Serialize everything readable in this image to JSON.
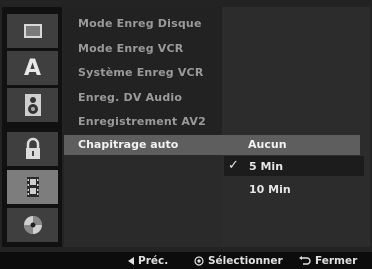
{
  "sidebar": {
    "icons": [
      {
        "name": "disc-panel-icon"
      },
      {
        "name": "language-a-icon"
      },
      {
        "name": "speaker-icon"
      },
      {
        "name": "lock-icon"
      },
      {
        "name": "film-strip-icon"
      },
      {
        "name": "disc-icon"
      }
    ],
    "selected_index": 4
  },
  "menu": {
    "items": [
      "Mode Enreg Disque",
      "Mode Enreg VCR",
      "Système Enreg VCR",
      "Enreg. DV Audio",
      "Enregistrement AV2"
    ],
    "highlighted": "Chapitrage auto",
    "current_value": "Aucun"
  },
  "options": {
    "items": [
      "5 Min",
      "10 Min"
    ],
    "checked_index": 0,
    "check_glyph": "✓"
  },
  "footer": {
    "prev_label": "Préc.",
    "select_label": "Sélectionner",
    "close_label": "Fermer"
  }
}
